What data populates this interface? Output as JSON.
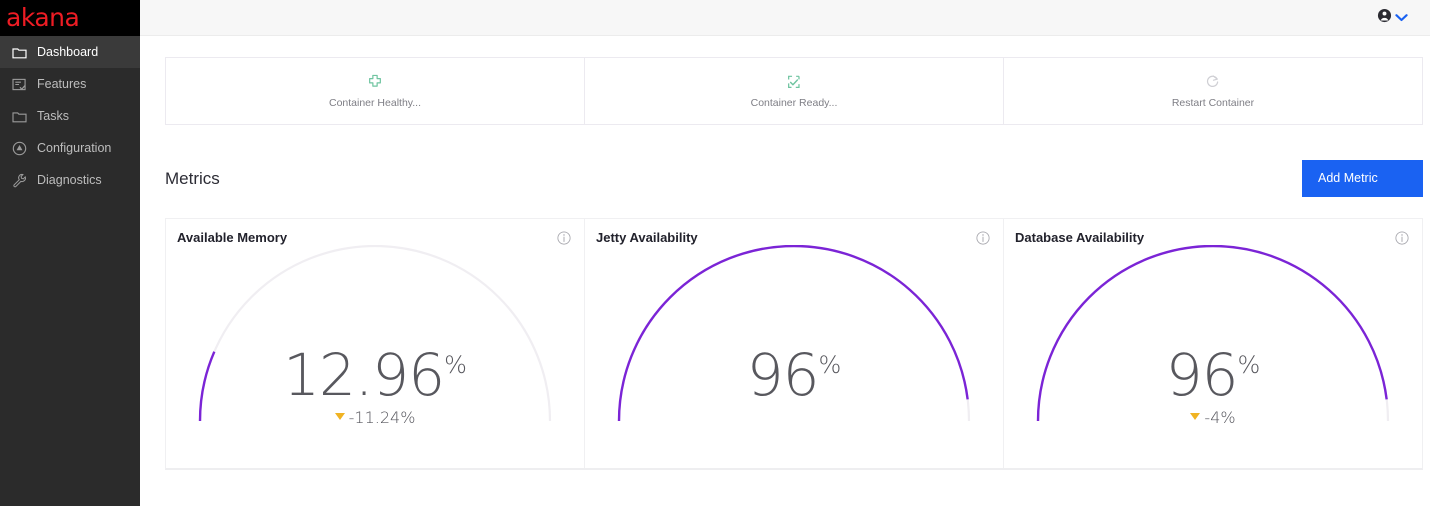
{
  "brand": {
    "logo_text": "akana",
    "logo_color": "#ed1c24"
  },
  "sidebar": {
    "items": [
      {
        "label": "Dashboard",
        "icon": "folder-icon",
        "active": true
      },
      {
        "label": "Features",
        "icon": "checklist-icon",
        "active": false
      },
      {
        "label": "Tasks",
        "icon": "folder-icon",
        "active": false
      },
      {
        "label": "Configuration",
        "icon": "circle-up-icon",
        "active": false
      },
      {
        "label": "Diagnostics",
        "icon": "wrench-icon",
        "active": false
      }
    ]
  },
  "topbar": {
    "account_icon": "account-circle-icon",
    "chevron_icon": "chevron-down-icon",
    "chevron_color": "#1a62f2"
  },
  "status_cards": [
    {
      "label": "Container Healthy...",
      "icon": "health-cross-icon",
      "color": "#6fc4a0"
    },
    {
      "label": "Container Ready...",
      "icon": "check-box-icon",
      "color": "#6fc4a0"
    },
    {
      "label": "Restart Container",
      "icon": "restart-icon",
      "color": "#cfcfd4"
    }
  ],
  "metrics_section": {
    "title": "Metrics",
    "add_button_label": "Add Metric",
    "add_button_color": "#1a62f2"
  },
  "chart_data": [
    {
      "type": "gauge",
      "title": "Available Memory",
      "value": 12.96,
      "value_text": "12.96",
      "unit": "%",
      "delta_text": "-11.24%",
      "delta_direction": "down",
      "delta_color": "#f0b323",
      "range": [
        0,
        100
      ],
      "arc_color": "#7b24d6",
      "track_color": "#f0eef2",
      "info_icon": "info-icon"
    },
    {
      "type": "gauge",
      "title": "Jetty Availability",
      "value": 96,
      "value_text": "96",
      "unit": "%",
      "delta_text": "",
      "delta_direction": "none",
      "range": [
        0,
        100
      ],
      "arc_color": "#7b24d6",
      "track_color": "#f0eef2",
      "info_icon": "info-icon"
    },
    {
      "type": "gauge",
      "title": "Database Availability",
      "value": 96,
      "value_text": "96",
      "unit": "%",
      "delta_text": "-4%",
      "delta_direction": "down",
      "delta_color": "#f0b323",
      "range": [
        0,
        100
      ],
      "arc_color": "#7b24d6",
      "track_color": "#f0eef2",
      "info_icon": "info-icon"
    }
  ]
}
